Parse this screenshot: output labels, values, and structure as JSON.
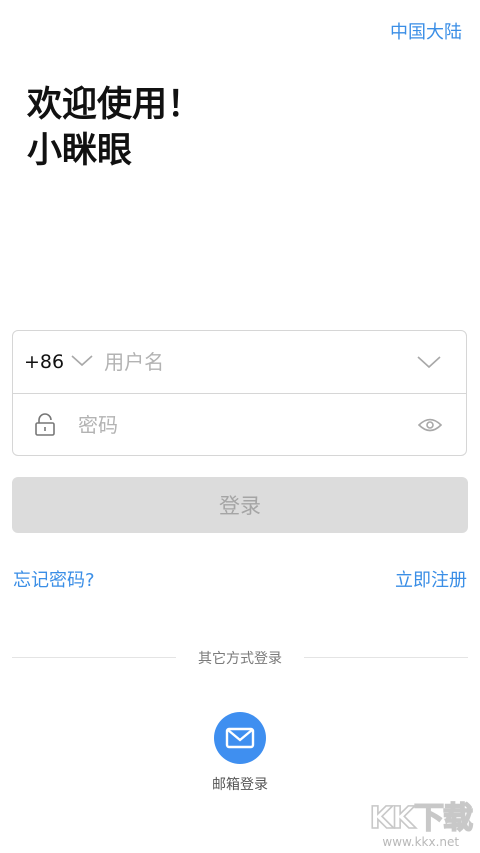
{
  "header": {
    "region": "中国大陆"
  },
  "welcome": {
    "line1": "欢迎使用！",
    "line2": "小眯眼"
  },
  "form": {
    "country_code": "+86",
    "username_placeholder": "用户名",
    "password_placeholder": "密码"
  },
  "actions": {
    "login_label": "登录",
    "forgot_password": "忘记密码?",
    "register": "立即注册"
  },
  "other_login": {
    "divider_text": "其它方式登录",
    "email_login_label": "邮箱登录",
    "email_icon": "mail-icon"
  },
  "watermark": {
    "logo": "KK下载",
    "url": "www.kkx.net"
  },
  "colors": {
    "accent": "#3a8ee6",
    "button_disabled_bg": "#dcdcdc",
    "button_disabled_text": "#a5a5a5",
    "mail_circle": "#3f8ff0"
  }
}
